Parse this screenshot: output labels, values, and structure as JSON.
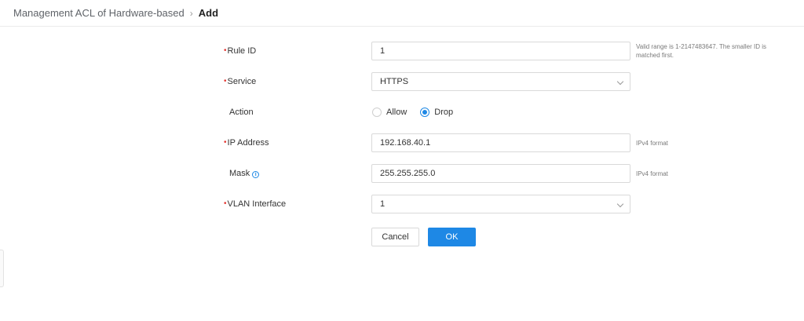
{
  "breadcrumb": {
    "parent": "Management ACL of Hardware-based",
    "separator": "›",
    "current": "Add"
  },
  "form": {
    "rule_id": {
      "label": "Rule ID",
      "required": true,
      "value": "1",
      "hint": "Valid range is 1-2147483647. The smaller ID is matched first."
    },
    "service": {
      "label": "Service",
      "required": true,
      "value": "HTTPS"
    },
    "action": {
      "label": "Action",
      "options": [
        {
          "label": "Allow",
          "checked": false
        },
        {
          "label": "Drop",
          "checked": true
        }
      ]
    },
    "ip_address": {
      "label": "IP Address",
      "required": true,
      "value": "192.168.40.1",
      "hint": "IPv4 format"
    },
    "mask": {
      "label": "Mask",
      "required": false,
      "value": "255.255.255.0",
      "hint": "IPv4 format",
      "info_icon": "info-icon"
    },
    "vlan_interface": {
      "label": "VLAN Interface",
      "required": true,
      "value": "1"
    }
  },
  "buttons": {
    "cancel": "Cancel",
    "ok": "OK"
  },
  "required_marker": "•",
  "colors": {
    "accent": "#1e88e5",
    "required": "#e53935",
    "border": "#d9d9d9"
  }
}
